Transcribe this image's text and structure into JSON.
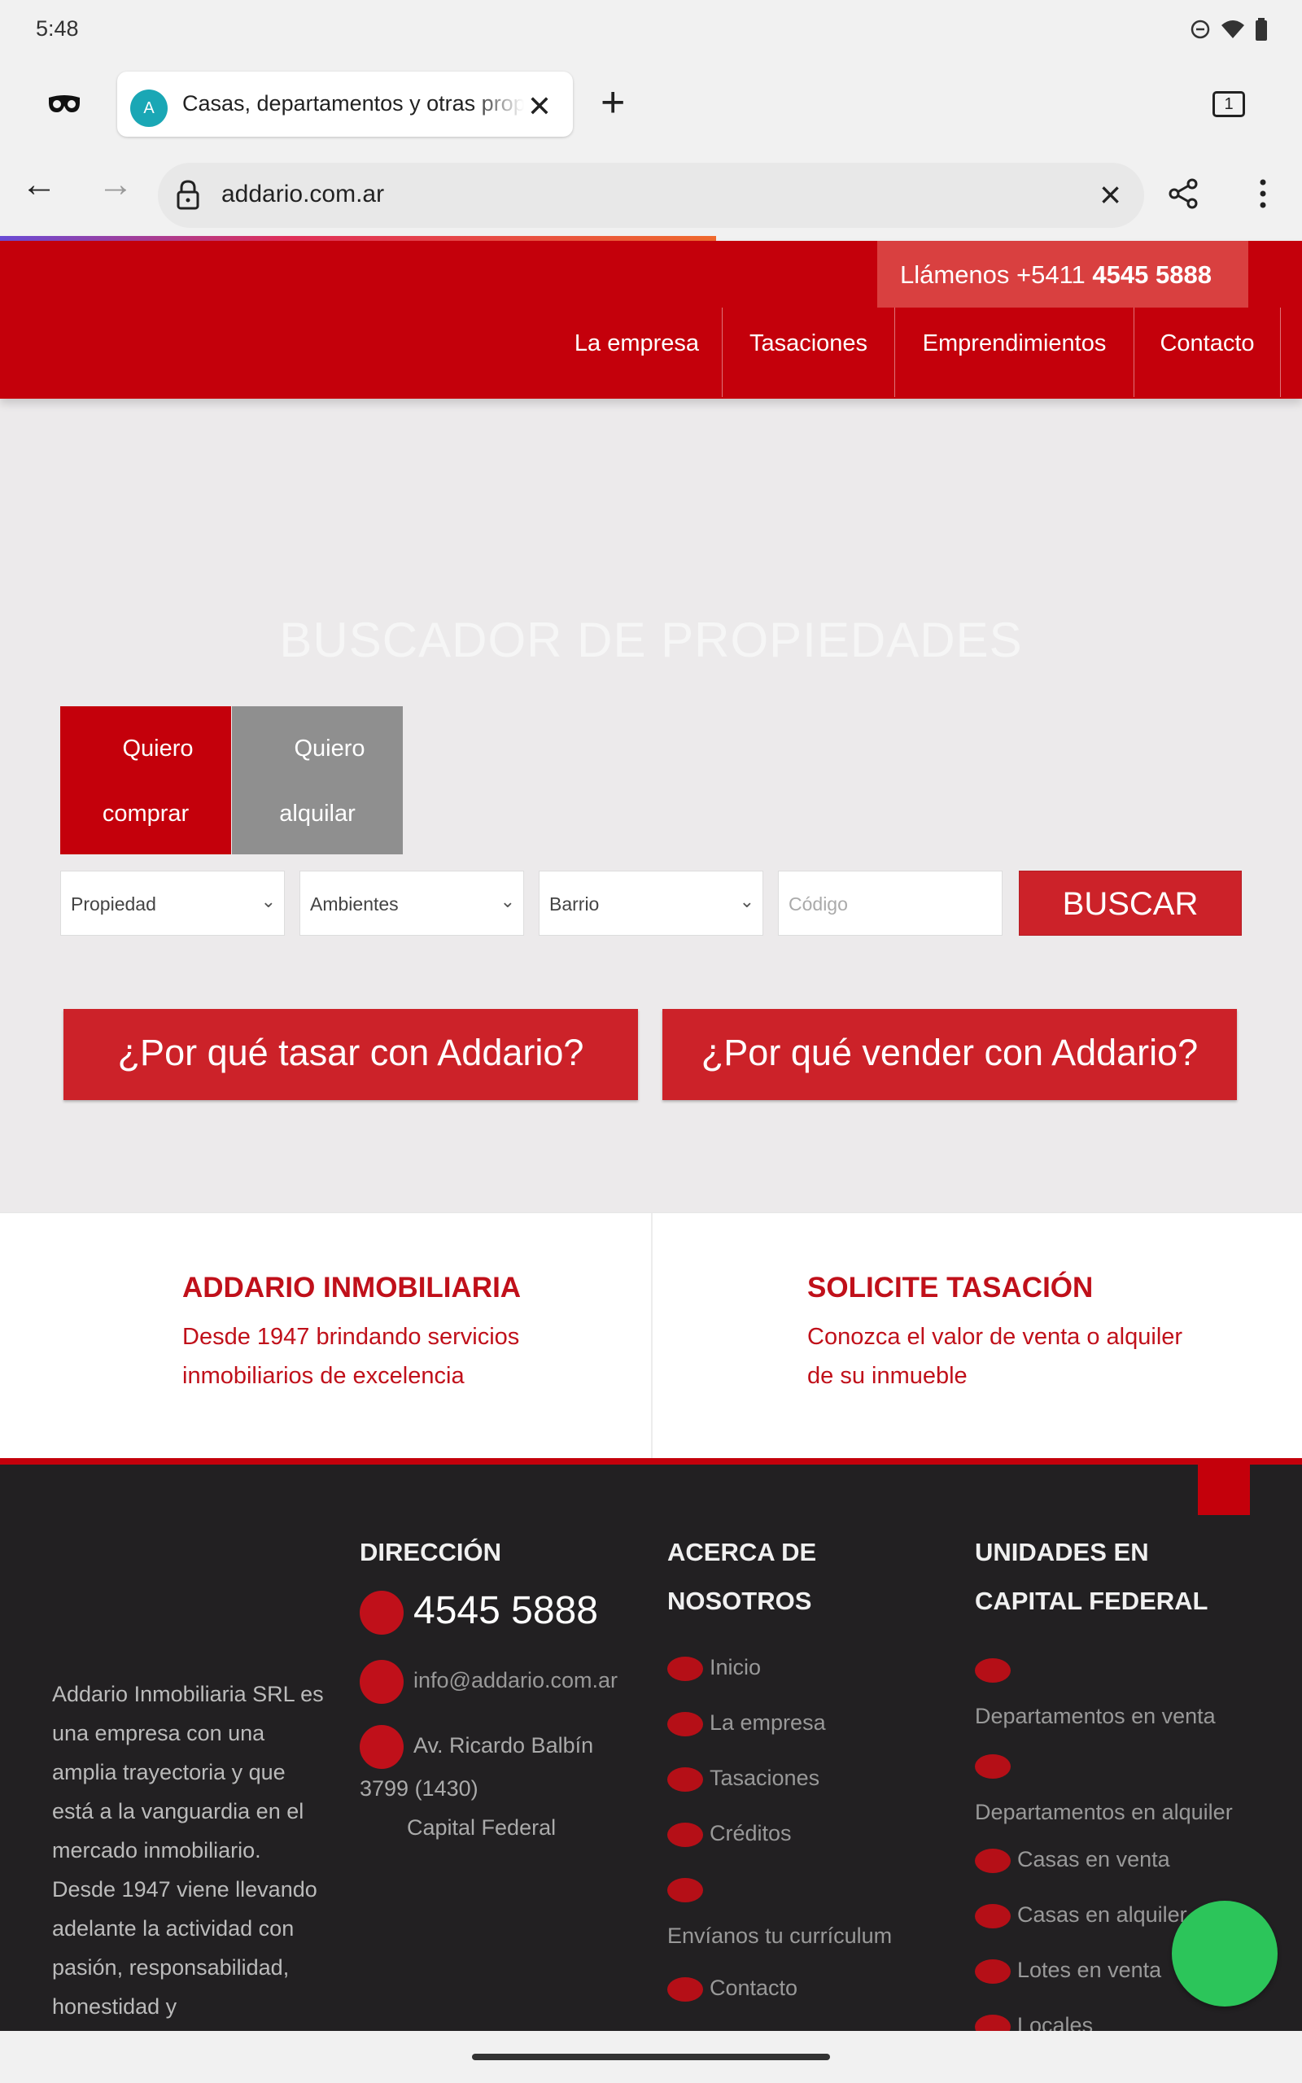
{
  "status_bar": {
    "time": "5:48"
  },
  "browser": {
    "tab_title": "Casas, departamentos y otras propiedades",
    "tab_favicon_letter": "A",
    "tab_count": "1",
    "url": "addario.com.ar",
    "icons": [
      "incognito-icon",
      "close-icon",
      "plus-icon",
      "tab-switcher-icon",
      "back-icon",
      "forward-icon",
      "lock-icon",
      "share-icon",
      "more-icon"
    ]
  },
  "header": {
    "call_prefix": "Llámenos +5411 ",
    "call_number": "4545 5888",
    "nav": [
      "La empresa",
      "Tasaciones",
      "Emprendimientos",
      "Contacto"
    ]
  },
  "search": {
    "title": "BUSCADOR DE PROPIEDADES",
    "tab_buy_line1": "Quiero",
    "tab_buy_line2": "comprar",
    "tab_rent_line1": "Quiero",
    "tab_rent_line2": "alquilar",
    "select_propiedad": "Propiedad",
    "select_ambientes": "Ambientes",
    "select_barrio": "Barrio",
    "codigo_placeholder": "Código",
    "buscar_label": "BUSCAR"
  },
  "cta": {
    "tasar": "¿Por qué tasar con Addario?",
    "vender": "¿Por qué vender con Addario?"
  },
  "info": {
    "left_title": "ADDARIO INMOBILIARIA",
    "left_text": "Desde 1947 brindando servicios inmobiliarios de excelencia",
    "right_title": "SOLICITE TASACIÓN",
    "right_text": "Conozca el valor de venta o alquiler de su inmueble"
  },
  "footer": {
    "about": "Addario Inmobiliaria SRL es una empresa con una amplia trayectoria y que está a la vanguardia en el mercado inmobiliario. Desde 1947 viene llevando adelante la actividad con pasión, responsabilidad, honestidad y",
    "direccion_title": "DIRECCIÓN",
    "phone": "4545 5888",
    "email": "info@addario.com.ar",
    "address_line1": "Av. Ricardo Balbín",
    "address_line2": "3799 (1430)",
    "address_line3": "Capital Federal",
    "acerca_title_1": "ACERCA DE",
    "acerca_title_2": "NOSOTROS",
    "acerca_links": [
      "Inicio",
      "La empresa",
      "Tasaciones",
      "Créditos",
      "Envíanos tu currículum",
      "Contacto"
    ],
    "unidades_title_1": "UNIDADES EN",
    "unidades_title_2": "CAPITAL FEDERAL",
    "unidades_links": [
      "Departamentos en venta",
      "Departamentos en alquiler",
      "Casas en venta",
      "Casas en alquiler",
      "Lotes en venta",
      "Locales"
    ]
  },
  "colors": {
    "brand_red": "#c4000b",
    "button_red": "#cc2229",
    "footer_bg": "#222022",
    "fab_green": "#2cc55a"
  }
}
